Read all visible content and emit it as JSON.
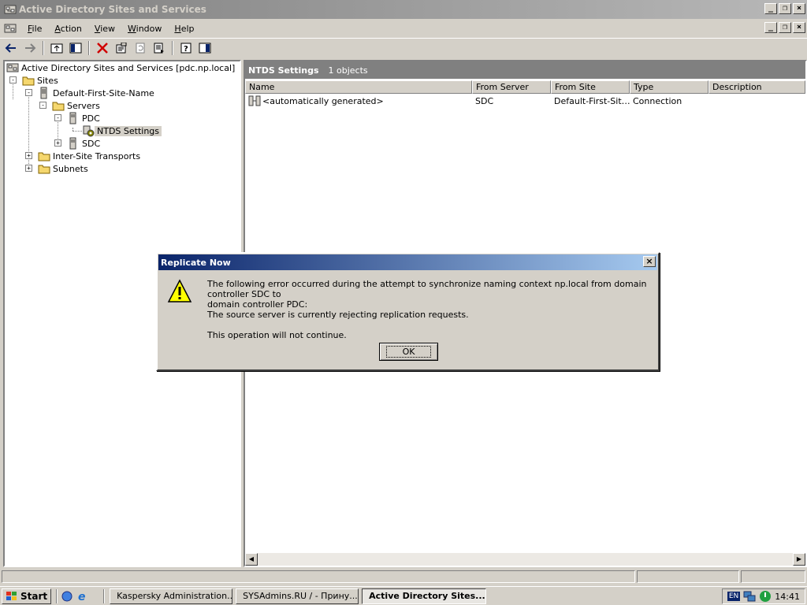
{
  "window": {
    "title": "Active Directory Sites and Services"
  },
  "menu": [
    {
      "key": "F",
      "rest": "ile"
    },
    {
      "key": "A",
      "rest": "ction"
    },
    {
      "key": "V",
      "rest": "iew"
    },
    {
      "key": "W",
      "rest": "indow"
    },
    {
      "key": "H",
      "rest": "elp"
    }
  ],
  "tree": {
    "root": "Active Directory Sites and Services [pdc.np.local]",
    "sites": "Sites",
    "default_site": "Default-First-Site-Name",
    "servers": "Servers",
    "pdc": "PDC",
    "ntds": "NTDS Settings",
    "sdc": "SDC",
    "inter_site": "Inter-Site Transports",
    "subnets": "Subnets"
  },
  "right_pane": {
    "title": "NTDS Settings",
    "count": "1 objects",
    "columns": [
      "Name",
      "From Server",
      "From Site",
      "Type",
      "Description"
    ],
    "rows": [
      {
        "name": "<automatically generated>",
        "from_server": "SDC",
        "from_site": "Default-First-Sit…",
        "type": "Connection",
        "description": ""
      }
    ]
  },
  "dialog": {
    "title": "Replicate Now",
    "line1": "The following error occurred during the attempt to synchronize naming context np.local from domain controller SDC to",
    "line2": "domain controller PDC:",
    "line3": "The source server is currently rejecting replication requests.",
    "line4": "This operation will not continue.",
    "ok_label": "OK",
    "close_glyph": "×"
  },
  "taskbar": {
    "start": "Start",
    "tasks": [
      "Kaspersky Administration...",
      "SYSAdmins.RU / - Прину...",
      "Active Directory Sites..."
    ],
    "lang": "EN",
    "clock": "14:41"
  }
}
